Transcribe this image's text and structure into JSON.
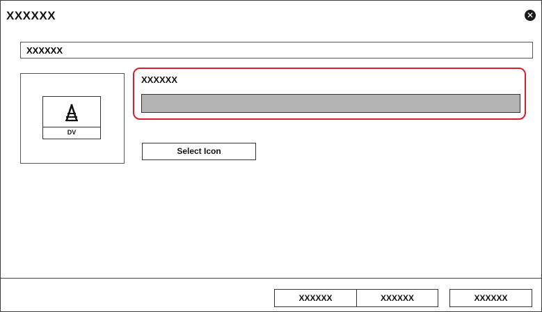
{
  "dialog": {
    "title": "XXXXXX",
    "close_icon": "close-icon"
  },
  "name_field": {
    "value": "XXXXXX"
  },
  "icon_preview": {
    "glyph_icon": "tower-antenna-icon",
    "glyph": "₳",
    "caption": "DV"
  },
  "selection": {
    "label": "XXXXXX",
    "value": ""
  },
  "select_icon_button": {
    "label": "Select Icon"
  },
  "footer": {
    "buttons": [
      {
        "label": "XXXXXX"
      },
      {
        "label": "XXXXXX"
      },
      {
        "label": "XXXXXX"
      }
    ]
  },
  "colors": {
    "highlight_border": "#d81e2d",
    "field_fill": "#b4b4b4"
  }
}
